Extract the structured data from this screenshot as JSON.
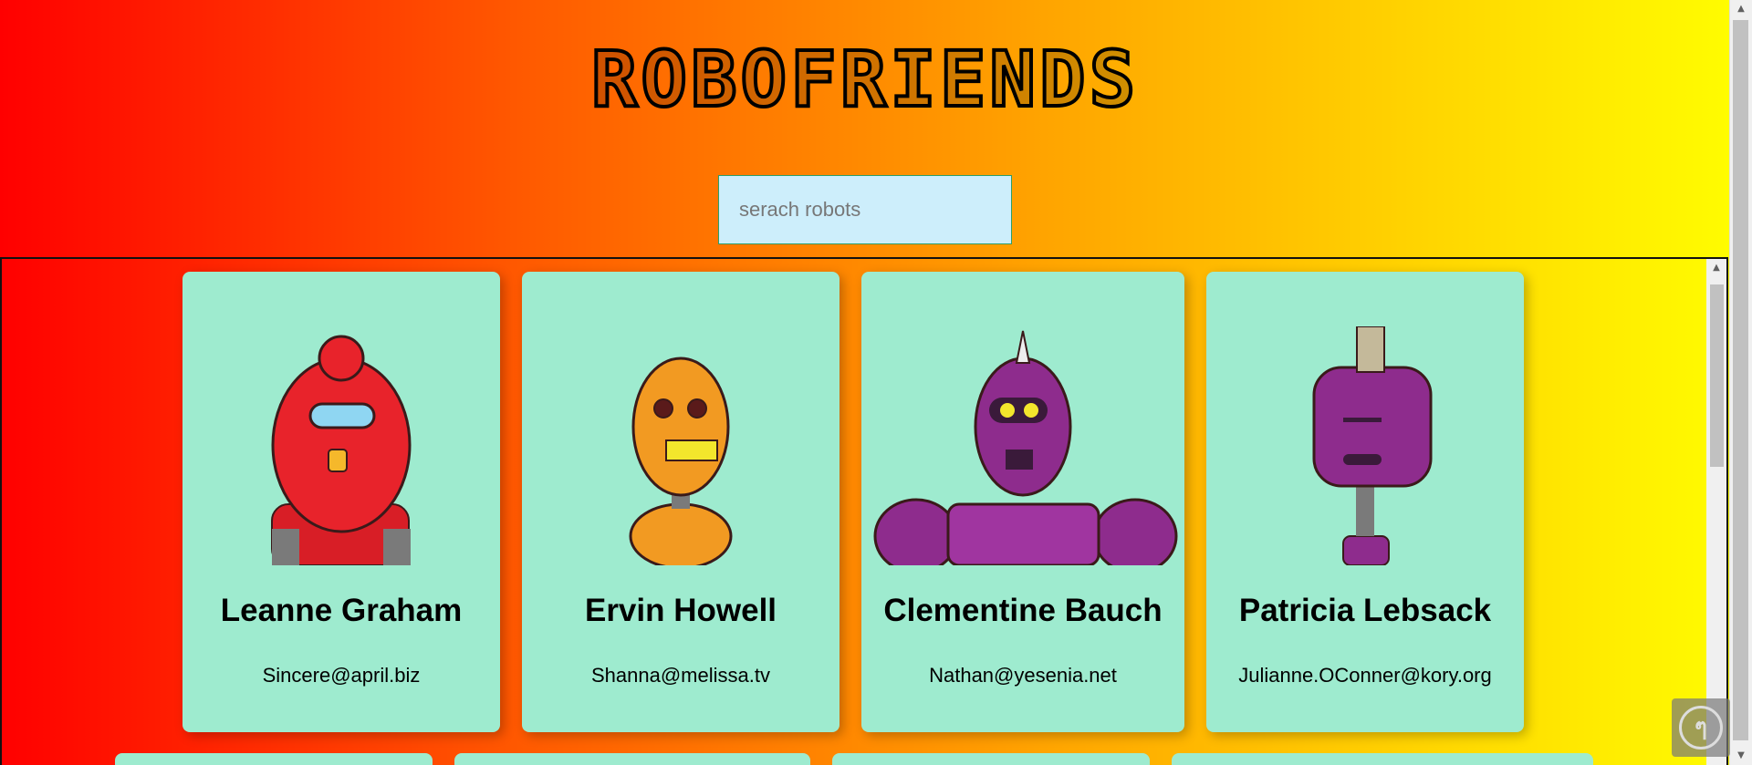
{
  "app": {
    "title": "RoboFriends"
  },
  "search": {
    "placeholder": "serach robots",
    "value": ""
  },
  "robots": [
    {
      "name": "Leanne Graham",
      "email": "Sincere@april.biz",
      "color": "#e8232b"
    },
    {
      "name": "Ervin Howell",
      "email": "Shanna@melissa.tv",
      "color": "#f29a22"
    },
    {
      "name": "Clementine Bauch",
      "email": "Nathan@yesenia.net",
      "color": "#8e2c8d"
    },
    {
      "name": "Patricia Lebsack",
      "email": "Julianne.OConner@kory.org",
      "color": "#8e2c8d"
    }
  ],
  "colors": {
    "card_bg": "#9eebcf",
    "search_bg": "#cdeefb"
  },
  "icons": {
    "badge": "logo-badge-icon"
  }
}
